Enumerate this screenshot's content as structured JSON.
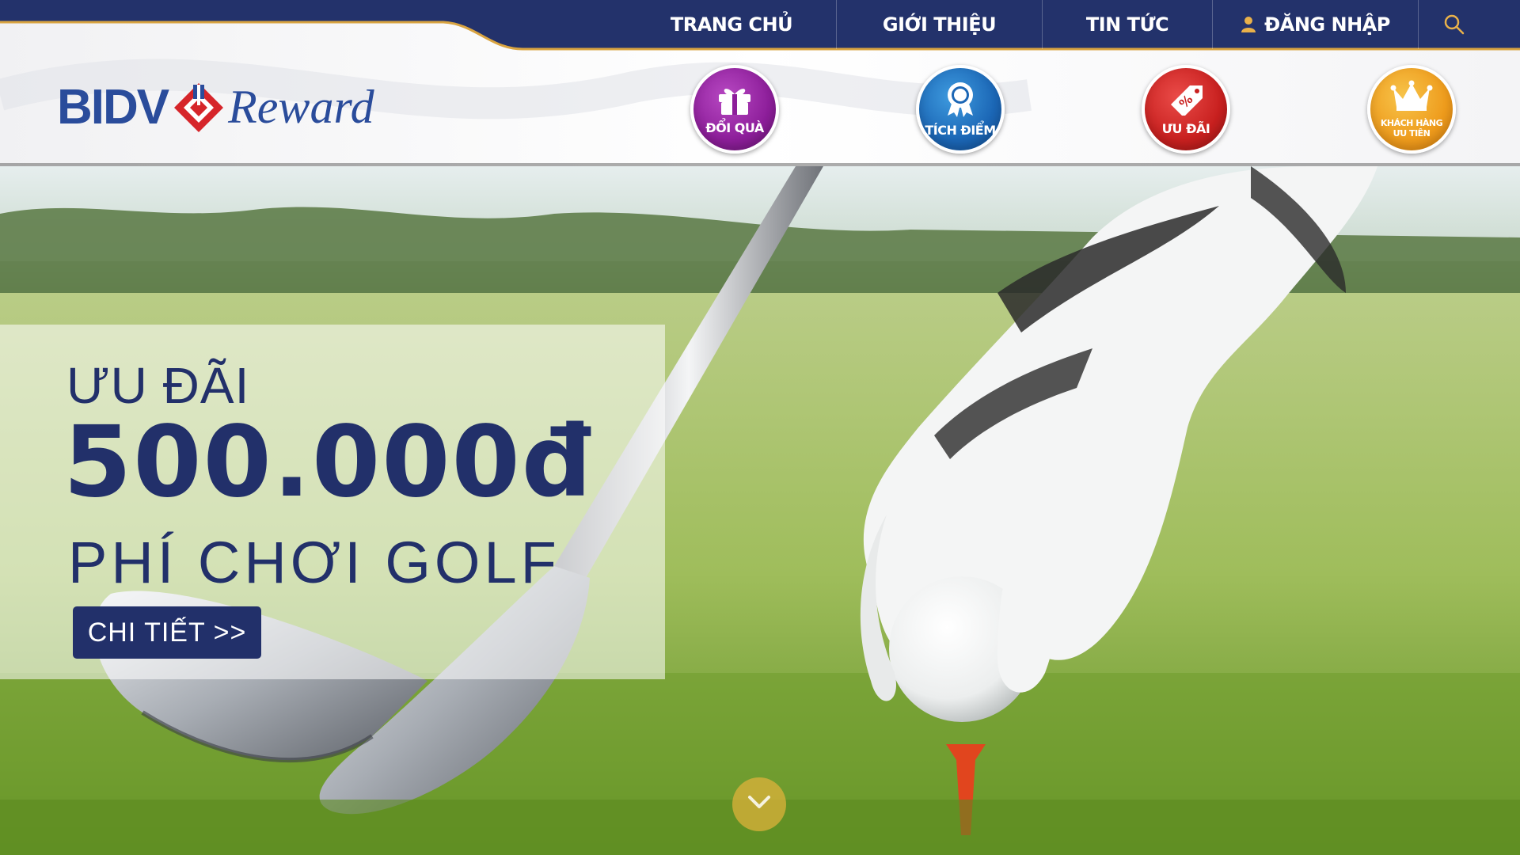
{
  "nav": {
    "home": "TRANG CHỦ",
    "about": "GIỚI THIỆU",
    "news": "TIN TỨC",
    "login": "ĐĂNG NHẬP"
  },
  "logo": {
    "brand": "BIDV",
    "product": "Reward"
  },
  "quick_links": [
    {
      "label": "ĐỔI QUÀ",
      "icon": "gift-icon",
      "color": "#8d1e9a"
    },
    {
      "label": "TÍCH ĐIỂM",
      "icon": "award-ribbon-icon",
      "color": "#1b66b5"
    },
    {
      "label": "ƯU ĐÃI",
      "icon": "discount-tag-icon",
      "color": "#c8201f"
    },
    {
      "label_line1": "KHÁCH HÀNG",
      "label_line2": "ƯU TIÊN",
      "icon": "crown-icon",
      "color": "#ee9b1c"
    }
  ],
  "hero": {
    "line1": "ƯU ĐÃI",
    "amount": "500.000đ",
    "line3": "PHÍ CHƠI GOLF",
    "cta": "CHI TIẾT >>"
  },
  "colors": {
    "navy": "#23326b",
    "brand_blue": "#2a4c9b",
    "gold_accent": "#d9a441"
  }
}
